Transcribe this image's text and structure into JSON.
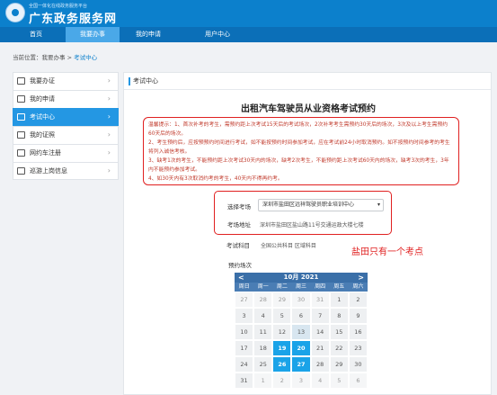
{
  "header": {
    "subtitle": "全国一体化在线政务服务平台",
    "title": "广东政务服务网",
    "colors": {
      "brand": "#0c80cc",
      "nav": "#0b6fb8",
      "nav_active": "#4aa8e8"
    }
  },
  "nav": {
    "items": [
      {
        "label": "首页"
      },
      {
        "label": "我要办事"
      },
      {
        "label": "我的申请"
      },
      {
        "label": "用户中心"
      }
    ],
    "active": "我要办事"
  },
  "breadcrumb": {
    "prefix": "当前位置：我要办事 > ",
    "current": "考试中心"
  },
  "sidebar": {
    "items": [
      {
        "label": "我要办证",
        "icon": "user-icon"
      },
      {
        "label": "我的申请",
        "icon": "edit-icon"
      },
      {
        "label": "考试中心",
        "icon": "exam-icon"
      },
      {
        "label": "我的证照",
        "icon": "id-card-icon"
      },
      {
        "label": "网约车注册",
        "icon": "car-icon"
      },
      {
        "label": "巡游上岗信息",
        "icon": "info-icon"
      }
    ],
    "active": "考试中心"
  },
  "panel": {
    "heading": "考试中心",
    "title": "出租汽车驾驶员从业资格考试预约",
    "notice_lines": [
      "温馨提示：1、首次补考的考生，需预约距上次考试15天后的考试场次，2次补考考生需预约30天后的场次，3次及以上考生需预约60天后的场次。",
      "2、考生预约后，应按预预约时间进行考试，如不能按预约时间参加考试，应在考试前24小时取消预约。如不按预约时间参考的考生将列入诚信考核。",
      "3、缺考1次的考生，不能预约距上次考试30天内的场次，缺考2次考生，不能预约距上次考试60天内的场次，缺考3次的考生，3年内不能预约参加考试。",
      "4、如30天内有3次取消约考的考生，40天内不得再约考。"
    ]
  },
  "form": {
    "venue_label": "选择考场",
    "venue_value": "深圳市盐田区远祥驾驶员职业培训中心",
    "address_label": "考场地址",
    "address_value": "深圳市盐田区盐山路11号交通运政大楼七楼",
    "subject_label": "考试科目",
    "subject_value": "全国公共科目  区域科目",
    "date_label": "预约场次"
  },
  "annotation": "盐田只有一个考点",
  "calendar": {
    "prev": "<",
    "next": ">",
    "title": "10月 2021",
    "weekdays": [
      "周日",
      "周一",
      "周二",
      "周三",
      "周四",
      "周五",
      "周六"
    ],
    "weeks": [
      [
        {
          "d": "27",
          "o": true
        },
        {
          "d": "28",
          "o": true
        },
        {
          "d": "29",
          "o": true
        },
        {
          "d": "30",
          "o": true
        },
        {
          "d": "31",
          "o": true
        },
        {
          "d": "1"
        },
        {
          "d": "2"
        }
      ],
      [
        {
          "d": "3"
        },
        {
          "d": "4"
        },
        {
          "d": "5"
        },
        {
          "d": "6"
        },
        {
          "d": "7"
        },
        {
          "d": "8"
        },
        {
          "d": "9"
        }
      ],
      [
        {
          "d": "10"
        },
        {
          "d": "11"
        },
        {
          "d": "12"
        },
        {
          "d": "13",
          "t": true
        },
        {
          "d": "14"
        },
        {
          "d": "15"
        },
        {
          "d": "16"
        }
      ],
      [
        {
          "d": "17"
        },
        {
          "d": "18"
        },
        {
          "d": "19",
          "s": true
        },
        {
          "d": "20",
          "s": true
        },
        {
          "d": "21"
        },
        {
          "d": "22"
        },
        {
          "d": "23"
        }
      ],
      [
        {
          "d": "24"
        },
        {
          "d": "25"
        },
        {
          "d": "26",
          "s": true
        },
        {
          "d": "27",
          "s": true
        },
        {
          "d": "28"
        },
        {
          "d": "29"
        },
        {
          "d": "30"
        }
      ],
      [
        {
          "d": "31"
        },
        {
          "d": "1",
          "o": true
        },
        {
          "d": "2",
          "o": true
        },
        {
          "d": "3",
          "o": true
        },
        {
          "d": "4",
          "o": true
        },
        {
          "d": "5",
          "o": true
        },
        {
          "d": "6",
          "o": true
        }
      ]
    ]
  }
}
